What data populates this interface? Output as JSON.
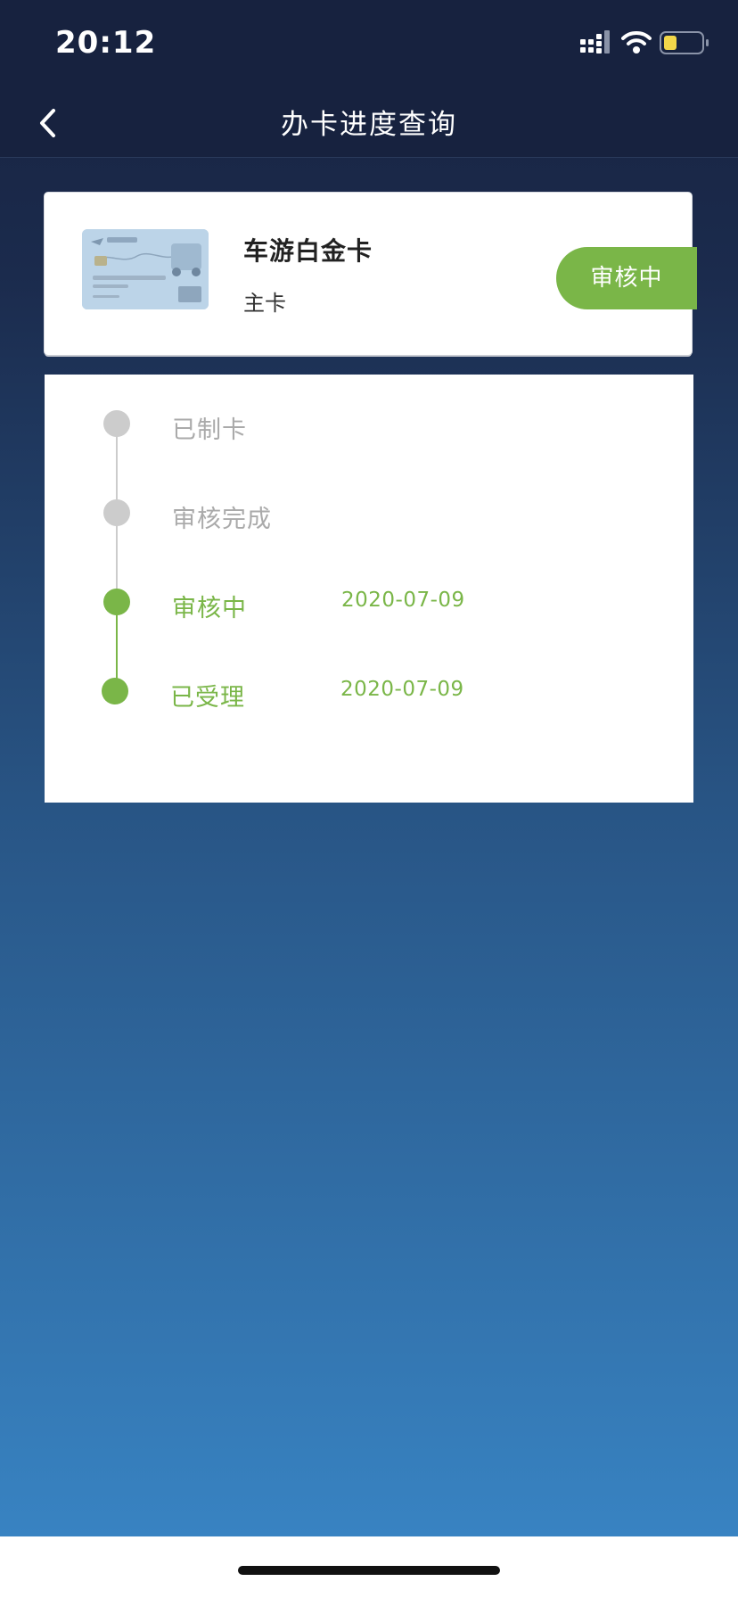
{
  "status_bar": {
    "time": "20:12",
    "icons": [
      "signal-icon",
      "wifi-icon",
      "battery-icon"
    ],
    "battery_color": "#f2d74a"
  },
  "nav": {
    "title": "办卡进度查询",
    "back_icon": "chevron-left-icon"
  },
  "card": {
    "name": "车游白金卡",
    "type": "主卡",
    "status": "审核中",
    "status_color": "#7ab648"
  },
  "progress": {
    "steps": [
      {
        "label": "已制卡",
        "date": "",
        "state": "pending"
      },
      {
        "label": "审核完成",
        "date": "",
        "state": "pending"
      },
      {
        "label": "审核中",
        "date": "2020-07-09",
        "state": "done"
      },
      {
        "label": "已受理",
        "date": "2020-07-09",
        "state": "done"
      }
    ],
    "active_color": "#7ab648",
    "inactive_color": "#cccccc"
  }
}
